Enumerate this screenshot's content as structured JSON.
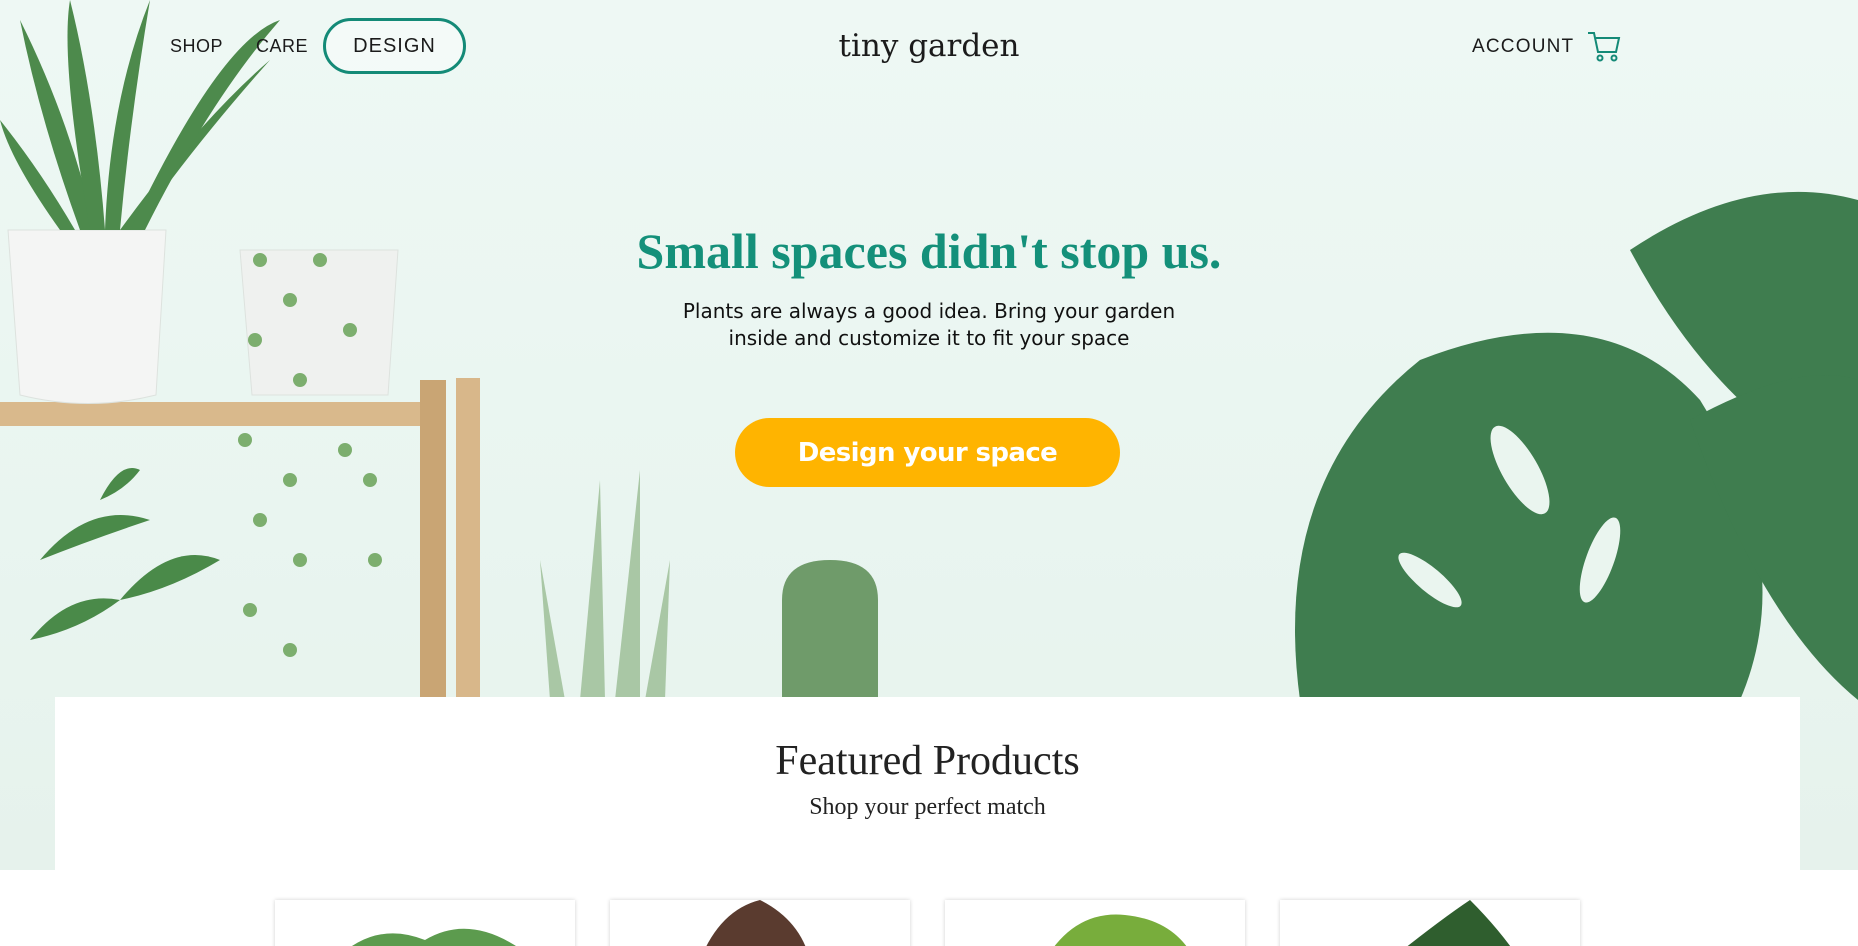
{
  "nav": {
    "shop": "SHOP",
    "care": "CARE",
    "design": "DESIGN",
    "logo": "tiny garden",
    "account": "ACCOUNT",
    "cart_icon": "cart-icon"
  },
  "hero": {
    "headline": "Small spaces didn't stop us.",
    "subline": "Plants are always a good idea. Bring your garden inside and customize it to fit your space",
    "cta": "Design your space"
  },
  "featured": {
    "title": "Featured Products",
    "subtitle": "Shop your perfect match"
  },
  "colors": {
    "accent": "#14907a",
    "cta": "#ffb400",
    "hero_bg": "#eef8f4"
  }
}
